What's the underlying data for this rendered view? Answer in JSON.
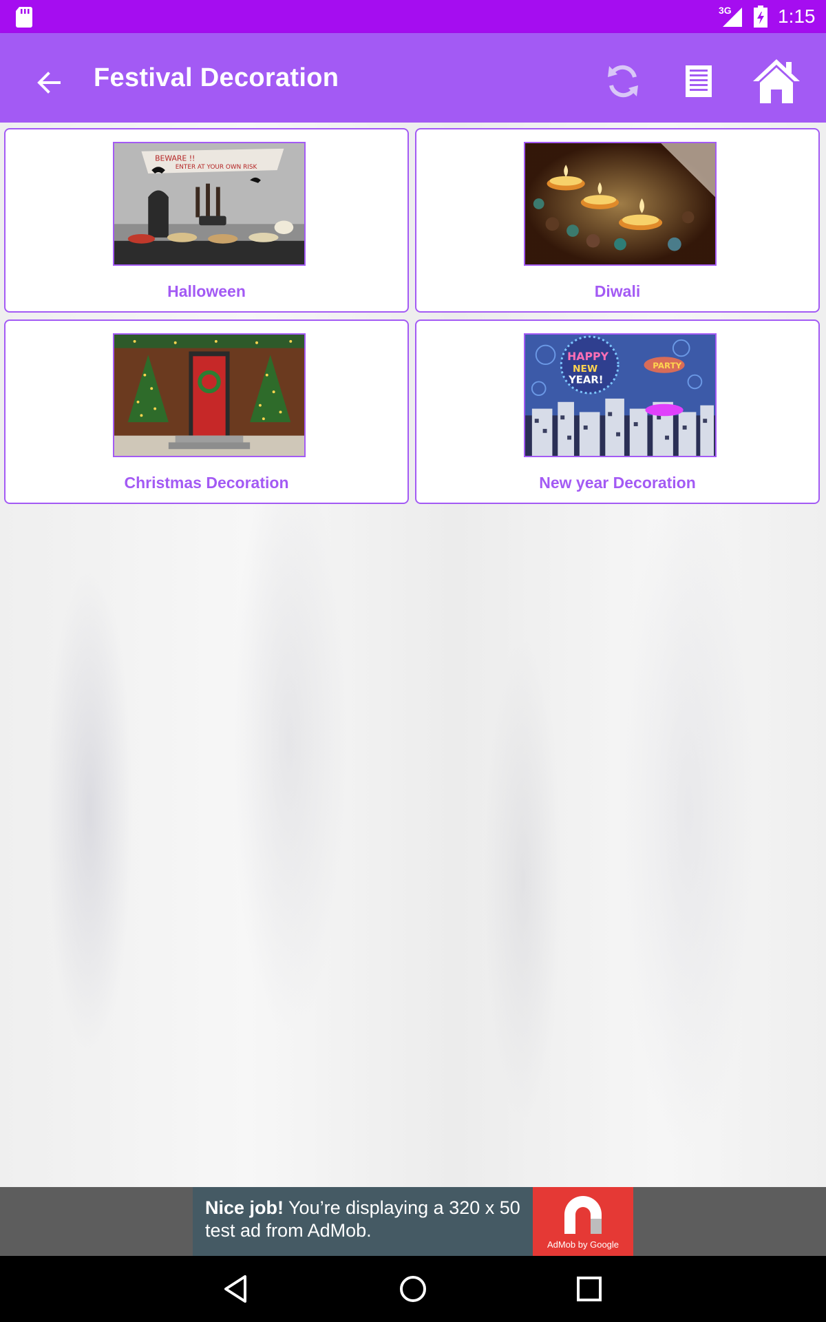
{
  "status_bar": {
    "network": "3G",
    "time": "1:15",
    "icons": [
      "sd-card-icon",
      "signal-icon",
      "battery-icon"
    ]
  },
  "app_bar": {
    "title": "Festival Decoration",
    "icons": [
      "back-arrow-icon",
      "refresh-icon",
      "list-icon",
      "home-icon"
    ]
  },
  "items": [
    {
      "label": "Halloween"
    },
    {
      "label": "Diwali"
    },
    {
      "label": "Christmas Decoration"
    },
    {
      "label": "New year Decoration"
    }
  ],
  "ad": {
    "bold_text": "Nice job!",
    "text": " You’re displaying a 320 x 50 test ad from AdMob.",
    "logo_text": "AdMob by Google"
  },
  "colors": {
    "status_bar": "#a50df0",
    "app_bar": "#a35af4",
    "accent": "#a35af4",
    "card_bg": "#ffffff",
    "ad_bg": "#455a64",
    "ad_logo": "#e53935",
    "nav_bar": "#000000"
  },
  "nav_bar": {
    "icons": [
      "nav-back-icon",
      "nav-home-icon",
      "nav-recents-icon"
    ]
  }
}
